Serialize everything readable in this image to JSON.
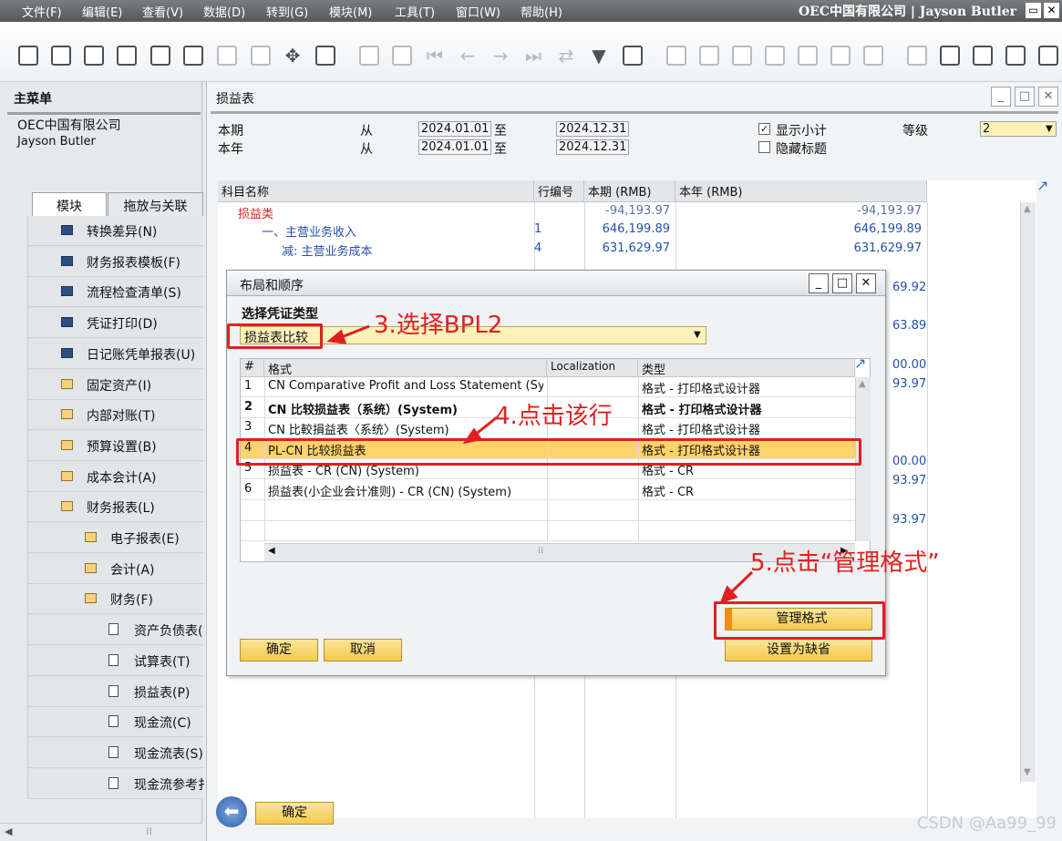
{
  "menubar": {
    "items": [
      "文件(F)",
      "编辑(E)",
      "查看(V)",
      "数据(D)",
      "转到(G)",
      "模块(M)",
      "工具(T)",
      "窗口(W)",
      "帮助(H)"
    ],
    "company": "OEC中国有限公司  |  Jayson Butler"
  },
  "left_panel": {
    "title": "主菜单",
    "company": "OEC中国有限公司",
    "user": "Jayson Butler",
    "tabs": [
      "模块",
      "拖放与关联"
    ],
    "tree": [
      {
        "label": "转换差异(N)",
        "icon": "list-icon"
      },
      {
        "label": "财务报表模板(F)",
        "icon": "list-icon"
      },
      {
        "label": "流程检查清单(S)",
        "icon": "list-icon"
      },
      {
        "label": "凭证打印(D)",
        "icon": "list-icon"
      },
      {
        "label": "日记账凭单报表(U)",
        "icon": "list-icon"
      },
      {
        "label": "固定资产(I)",
        "icon": "folder-icon"
      },
      {
        "label": "内部对账(T)",
        "icon": "folder-icon"
      },
      {
        "label": "预算设置(B)",
        "icon": "folder-icon"
      },
      {
        "label": "成本会计(A)",
        "icon": "folder-icon"
      },
      {
        "label": "财务报表(L)",
        "icon": "folder-open-icon"
      },
      {
        "label": "电子报表(E)",
        "icon": "folder-icon"
      },
      {
        "label": "会计(A)",
        "icon": "folder-icon"
      },
      {
        "label": "财务(F)",
        "icon": "folder-open-icon"
      },
      {
        "label": "资产负债表(",
        "icon": "document-icon"
      },
      {
        "label": "试算表(T)",
        "icon": "document-icon"
      },
      {
        "label": "损益表(P)",
        "icon": "document-icon"
      },
      {
        "label": "现金流(C)",
        "icon": "document-icon"
      },
      {
        "label": "现金流表(S)",
        "icon": "document-icon"
      },
      {
        "label": "现金流参考扌",
        "icon": "document-icon"
      }
    ]
  },
  "main": {
    "title": "损益表",
    "period_label": "本期",
    "year_label": "本年",
    "from_label": "从",
    "to_label": "至",
    "period_from": "2024.01.01",
    "period_to": "2024.12.31",
    "year_from": "2024.01.01",
    "year_to": "2024.12.31",
    "show_subtotal": "显示小计",
    "hide_header": "隐藏标题",
    "level_label": "等级",
    "level_value": "2",
    "columns": [
      "科目名称",
      "行编号",
      "本期 (RMB)",
      "本年 (RMB)"
    ],
    "rows": [
      {
        "name": "损益类",
        "line": "",
        "period": "-94,193.97",
        "year": "-94,193.97"
      },
      {
        "name": "一、主营业务收入",
        "line": "1",
        "period": "646,199.89",
        "year": "646,199.89"
      },
      {
        "name": "减: 主营业务成本",
        "line": "4",
        "period": "631,629.97",
        "year": "631,629.97"
      }
    ],
    "right_values": [
      "69.92",
      "63.89",
      "00.00",
      "93.97",
      "00.00",
      "93.97",
      "93.97"
    ],
    "ok_button": "确定"
  },
  "dialog": {
    "title": "布局和顺序",
    "section_label": "选择凭证类型",
    "select_value": "损益表比较",
    "columns": [
      "#",
      "格式",
      "Localization",
      "类型"
    ],
    "rows": [
      {
        "num": "1",
        "format": "CN Comparative Profit and Loss Statement (System)",
        "loc": "",
        "type": "格式 - 打印格式设计器"
      },
      {
        "num": "2",
        "format": "CN 比较损益表（系统）(System)",
        "loc": "",
        "type": "格式 - 打印格式设计器"
      },
      {
        "num": "3",
        "format": "CN 比較損益表〈系统〉(System)",
        "loc": "",
        "type": "格式 - 打印格式设计器"
      },
      {
        "num": "4",
        "format": "PL-CN 比较损益表",
        "loc": "",
        "type": "格式 - 打印格式设计器"
      },
      {
        "num": "5",
        "format": "损益表 - CR (CN) (System)",
        "loc": "",
        "type": "格式 - CR"
      },
      {
        "num": "6",
        "format": "损益表(小企业会计准则) - CR (CN) (System)",
        "loc": "",
        "type": "格式 - CR"
      }
    ],
    "manage_button": "管理格式",
    "default_button": "设置为缺省",
    "ok_button": "确定",
    "cancel_button": "取消"
  },
  "annotations": {
    "step3": "3.选择BPL2",
    "step4": "4.点击该行",
    "step5": "5.点击“管理格式”"
  },
  "watermark": "CSDN @Aa99_99",
  "colors": {
    "highlight": "#ffd36b",
    "annotation": "#e02020",
    "select_bg": "#fdf3b9"
  }
}
